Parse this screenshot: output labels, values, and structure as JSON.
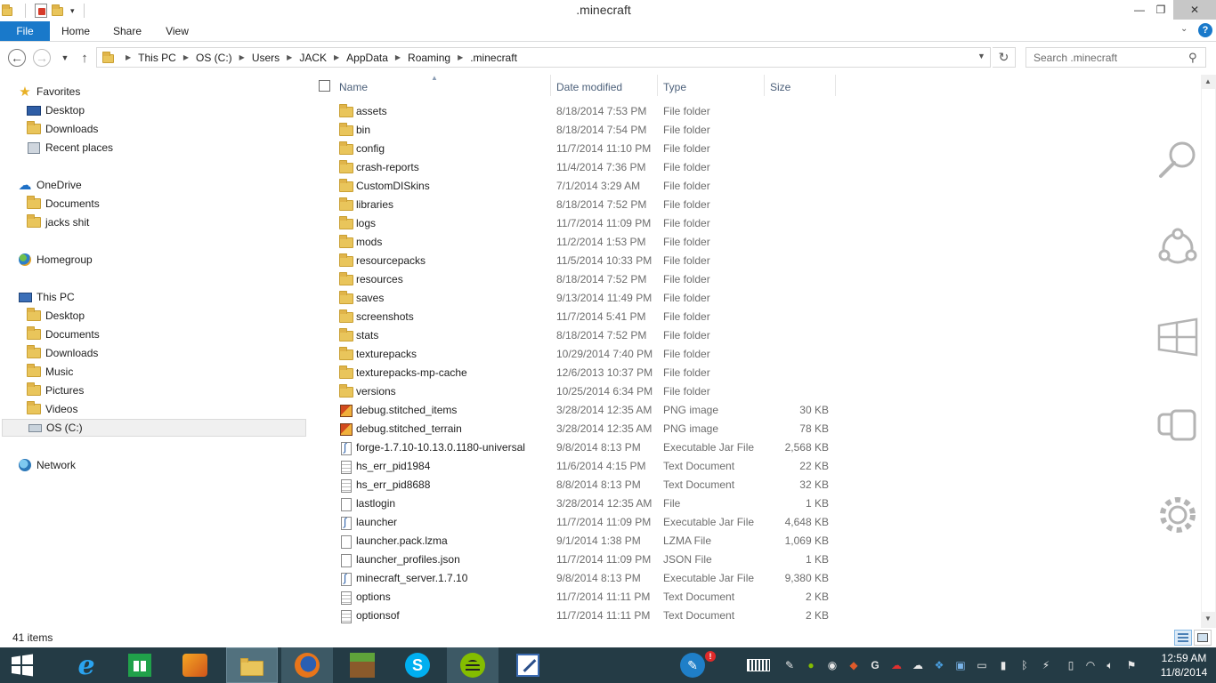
{
  "window": {
    "title": ".minecraft",
    "controls": {
      "minimize": "—",
      "maximize": "❐",
      "close": "✕"
    }
  },
  "ribbon": {
    "tabs": [
      {
        "label": "File"
      },
      {
        "label": "Home"
      },
      {
        "label": "Share"
      },
      {
        "label": "View"
      }
    ],
    "help": "?"
  },
  "address": {
    "crumbs": [
      "This PC",
      "OS (C:)",
      "Users",
      "JACK",
      "AppData",
      "Roaming",
      ".minecraft"
    ]
  },
  "search": {
    "placeholder": "Search .minecraft"
  },
  "nav": {
    "favorites": {
      "label": "Favorites",
      "items": [
        "Desktop",
        "Downloads",
        "Recent places"
      ]
    },
    "onedrive": {
      "label": "OneDrive",
      "items": [
        "Documents",
        "jacks shit"
      ]
    },
    "homegroup": {
      "label": "Homegroup"
    },
    "thispc": {
      "label": "This PC",
      "items": [
        "Desktop",
        "Documents",
        "Downloads",
        "Music",
        "Pictures",
        "Videos",
        "OS (C:)"
      ]
    },
    "network": {
      "label": "Network"
    }
  },
  "columns": {
    "name": "Name",
    "date": "Date modified",
    "type": "Type",
    "size": "Size"
  },
  "files": [
    {
      "icon": "folder-icon",
      "name": "assets",
      "date": "8/18/2014 7:53 PM",
      "type": "File folder",
      "size": ""
    },
    {
      "icon": "folder-icon",
      "name": "bin",
      "date": "8/18/2014 7:54 PM",
      "type": "File folder",
      "size": ""
    },
    {
      "icon": "folder-icon",
      "name": "config",
      "date": "11/7/2014 11:10 PM",
      "type": "File folder",
      "size": ""
    },
    {
      "icon": "folder-icon",
      "name": "crash-reports",
      "date": "11/4/2014 7:36 PM",
      "type": "File folder",
      "size": ""
    },
    {
      "icon": "folder-icon",
      "name": "CustomDISkins",
      "date": "7/1/2014 3:29 AM",
      "type": "File folder",
      "size": ""
    },
    {
      "icon": "folder-icon",
      "name": "libraries",
      "date": "8/18/2014 7:52 PM",
      "type": "File folder",
      "size": ""
    },
    {
      "icon": "folder-icon",
      "name": "logs",
      "date": "11/7/2014 11:09 PM",
      "type": "File folder",
      "size": ""
    },
    {
      "icon": "folder-icon",
      "name": "mods",
      "date": "11/2/2014 1:53 PM",
      "type": "File folder",
      "size": ""
    },
    {
      "icon": "folder-icon",
      "name": "resourcepacks",
      "date": "11/5/2014 10:33 PM",
      "type": "File folder",
      "size": ""
    },
    {
      "icon": "folder-icon",
      "name": "resources",
      "date": "8/18/2014 7:52 PM",
      "type": "File folder",
      "size": ""
    },
    {
      "icon": "folder-icon",
      "name": "saves",
      "date": "9/13/2014 11:49 PM",
      "type": "File folder",
      "size": ""
    },
    {
      "icon": "folder-icon",
      "name": "screenshots",
      "date": "11/7/2014 5:41 PM",
      "type": "File folder",
      "size": ""
    },
    {
      "icon": "folder-icon",
      "name": "stats",
      "date": "8/18/2014 7:52 PM",
      "type": "File folder",
      "size": ""
    },
    {
      "icon": "folder-icon",
      "name": "texturepacks",
      "date": "10/29/2014 7:40 PM",
      "type": "File folder",
      "size": ""
    },
    {
      "icon": "folder-icon",
      "name": "texturepacks-mp-cache",
      "date": "12/6/2013 10:37 PM",
      "type": "File folder",
      "size": ""
    },
    {
      "icon": "folder-icon",
      "name": "versions",
      "date": "10/25/2014 6:34 PM",
      "type": "File folder",
      "size": ""
    },
    {
      "icon": "png-image-icon",
      "name": "debug.stitched_items",
      "date": "3/28/2014 12:35 AM",
      "type": "PNG image",
      "size": "30 KB"
    },
    {
      "icon": "png-image-icon",
      "name": "debug.stitched_terrain",
      "date": "3/28/2014 12:35 AM",
      "type": "PNG image",
      "size": "78 KB"
    },
    {
      "icon": "jar-file-icon",
      "name": "forge-1.7.10-10.13.0.1180-universal",
      "date": "9/8/2014 8:13 PM",
      "type": "Executable Jar File",
      "size": "2,568 KB"
    },
    {
      "icon": "text-document-icon",
      "name": "hs_err_pid1984",
      "date": "11/6/2014 4:15 PM",
      "type": "Text Document",
      "size": "22 KB"
    },
    {
      "icon": "text-document-icon",
      "name": "hs_err_pid8688",
      "date": "8/8/2014 8:13 PM",
      "type": "Text Document",
      "size": "32 KB"
    },
    {
      "icon": "blank-file-icon",
      "name": "lastlogin",
      "date": "3/28/2014 12:35 AM",
      "type": "File",
      "size": "1 KB"
    },
    {
      "icon": "jar-file-icon",
      "name": "launcher",
      "date": "11/7/2014 11:09 PM",
      "type": "Executable Jar File",
      "size": "4,648 KB"
    },
    {
      "icon": "blank-file-icon",
      "name": "launcher.pack.lzma",
      "date": "9/1/2014 1:38 PM",
      "type": "LZMA File",
      "size": "1,069 KB"
    },
    {
      "icon": "blank-file-icon",
      "name": "launcher_profiles.json",
      "date": "11/7/2014 11:09 PM",
      "type": "JSON File",
      "size": "1 KB"
    },
    {
      "icon": "jar-file-icon",
      "name": "minecraft_server.1.7.10",
      "date": "9/8/2014 8:13 PM",
      "type": "Executable Jar File",
      "size": "9,380 KB"
    },
    {
      "icon": "text-document-icon",
      "name": "options",
      "date": "11/7/2014 11:11 PM",
      "type": "Text Document",
      "size": "2 KB"
    },
    {
      "icon": "text-document-icon",
      "name": "optionsof",
      "date": "11/7/2014 11:11 PM",
      "type": "Text Document",
      "size": "2 KB"
    }
  ],
  "status": {
    "item_count": "41 items"
  },
  "clock": {
    "time": "12:59 AM",
    "date": "11/8/2014"
  },
  "colors": {
    "accent": "#1979ca",
    "taskbar": "#243b45",
    "folder": "#e9c55b"
  }
}
